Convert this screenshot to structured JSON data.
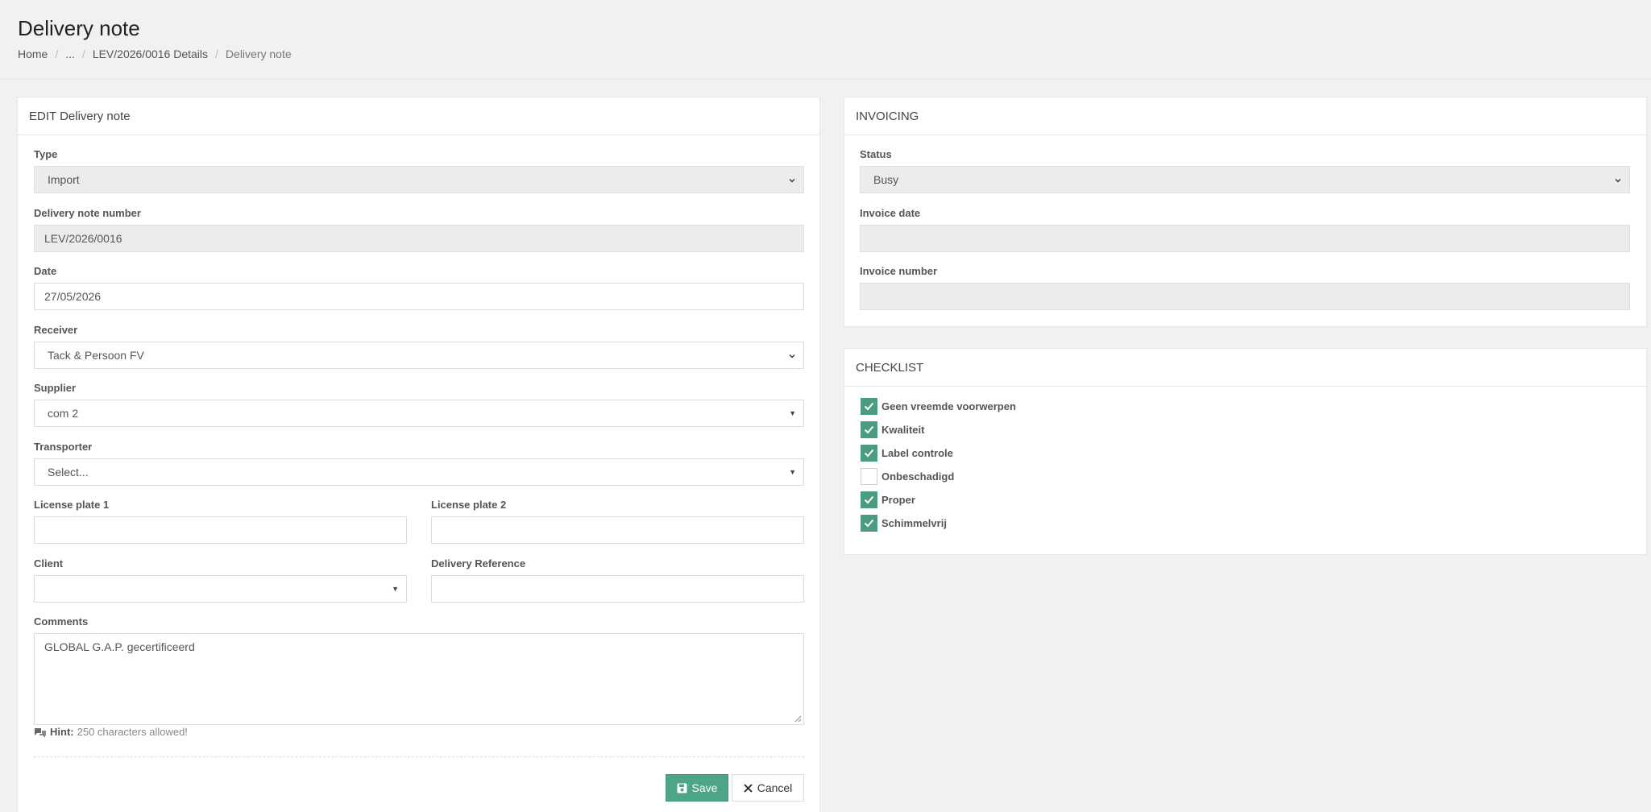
{
  "page": {
    "title": "Delivery note",
    "breadcrumb": [
      "Home",
      "...",
      "LEV/2026/0016 Details",
      "Delivery note"
    ]
  },
  "edit_card": {
    "title": "EDIT Delivery note",
    "type": {
      "label": "Type",
      "value": "Import"
    },
    "delivery_note_number": {
      "label": "Delivery note number",
      "value": "LEV/2026/0016"
    },
    "date": {
      "label": "Date",
      "value": "27/05/2026"
    },
    "receiver": {
      "label": "Receiver",
      "value": "Tack & Persoon FV"
    },
    "supplier": {
      "label": "Supplier",
      "value": "com 2"
    },
    "transporter": {
      "label": "Transporter",
      "placeholder": "Select..."
    },
    "license_plate_1": {
      "label": "License plate 1",
      "value": ""
    },
    "license_plate_2": {
      "label": "License plate 2",
      "value": ""
    },
    "client": {
      "label": "Client",
      "value": ""
    },
    "delivery_reference": {
      "label": "Delivery Reference",
      "value": ""
    },
    "comments": {
      "label": "Comments",
      "value": "GLOBAL G.A.P. gecertificeerd"
    },
    "hint": {
      "bold": "Hint:",
      "text": "250 characters allowed!"
    },
    "save_label": "Save",
    "cancel_label": "Cancel"
  },
  "invoicing_card": {
    "title": "INVOICING",
    "status": {
      "label": "Status",
      "value": "Busy"
    },
    "invoice_date": {
      "label": "Invoice date",
      "value": ""
    },
    "invoice_number": {
      "label": "Invoice number",
      "value": ""
    }
  },
  "checklist_card": {
    "title": "CHECKLIST",
    "items": [
      {
        "label": "Geen vreemde voorwerpen",
        "checked": true
      },
      {
        "label": "Kwaliteit",
        "checked": true
      },
      {
        "label": "Label controle",
        "checked": true
      },
      {
        "label": "Onbeschadigd",
        "checked": false
      },
      {
        "label": "Proper",
        "checked": true
      },
      {
        "label": "Schimmelvrij",
        "checked": true
      }
    ]
  },
  "colors": {
    "accent": "#4ca586",
    "checkbox": "#4b9b7e",
    "background": "#f1f1f1"
  }
}
